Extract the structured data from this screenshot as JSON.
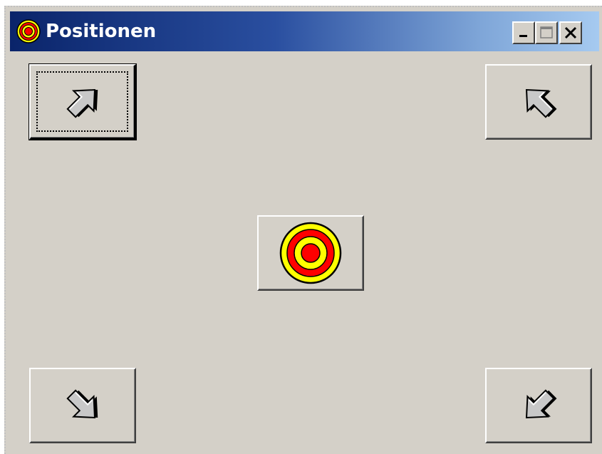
{
  "window": {
    "title": "Positionen",
    "icon": "target-icon"
  },
  "caption_buttons": [
    {
      "name": "minimize-button",
      "icon": "minimize-icon"
    },
    {
      "name": "maximize-button",
      "icon": "maximize-icon"
    },
    {
      "name": "close-button",
      "icon": "close-icon"
    }
  ],
  "buttons": [
    {
      "name": "top-left-button",
      "icon": "arrow-up-left-icon",
      "focused": true
    },
    {
      "name": "top-right-button",
      "icon": "arrow-up-right-icon",
      "focused": false
    },
    {
      "name": "center-button",
      "icon": "target-icon",
      "focused": false
    },
    {
      "name": "bottom-left-button",
      "icon": "arrow-down-left-icon",
      "focused": false
    },
    {
      "name": "bottom-right-button",
      "icon": "arrow-down-right-icon",
      "focused": false
    }
  ],
  "colors": {
    "titlebar_start": "#0a246a",
    "titlebar_end": "#a6caf0",
    "face": "#d4d0c8",
    "target_red": "#ff0000",
    "target_yellow": "#ffff00"
  }
}
